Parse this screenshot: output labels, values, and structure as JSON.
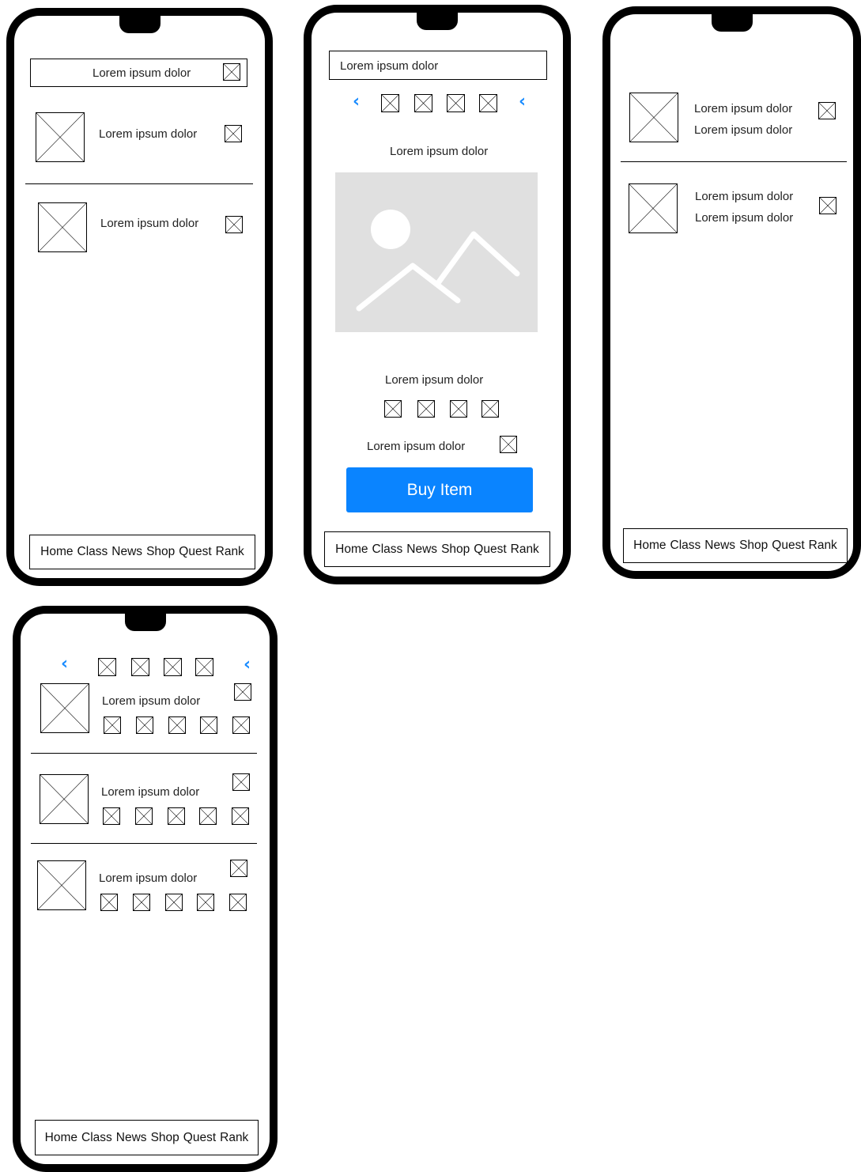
{
  "nav_items": [
    "Home",
    "Class",
    "News",
    "Shop",
    "Quest",
    "Rank"
  ],
  "screen1": {
    "search_text": "Lorem ipsum dolor",
    "rows": [
      {
        "label": "Lorem ipsum dolor"
      },
      {
        "label": "Lorem ipsum dolor"
      }
    ]
  },
  "screen2": {
    "search_text": "Lorem ipsum dolor",
    "carousel_prev": "‹",
    "carousel_next": "‹",
    "title": "Lorem ipsum dolor",
    "image_alt": "image-placeholder",
    "caption": "Lorem ipsum dolor",
    "option_label": "Lorem ipsum dolor",
    "buy_button": "Buy Item"
  },
  "screen3": {
    "rows": [
      {
        "line1": "Lorem ipsum dolor",
        "line2": "Lorem ipsum dolor"
      },
      {
        "line1": "Lorem ipsum dolor",
        "line2": "Lorem ipsum dolor"
      }
    ]
  },
  "screen4": {
    "carousel_prev": "‹",
    "carousel_next": "‹",
    "rows": [
      {
        "label": "Lorem ipsum dolor"
      },
      {
        "label": "Lorem ipsum dolor"
      },
      {
        "label": "Lorem ipsum dolor"
      }
    ]
  },
  "colors": {
    "accent": "#0a84ff",
    "chevron": "#1a8cff",
    "image_placeholder": "#e0e0e0"
  }
}
